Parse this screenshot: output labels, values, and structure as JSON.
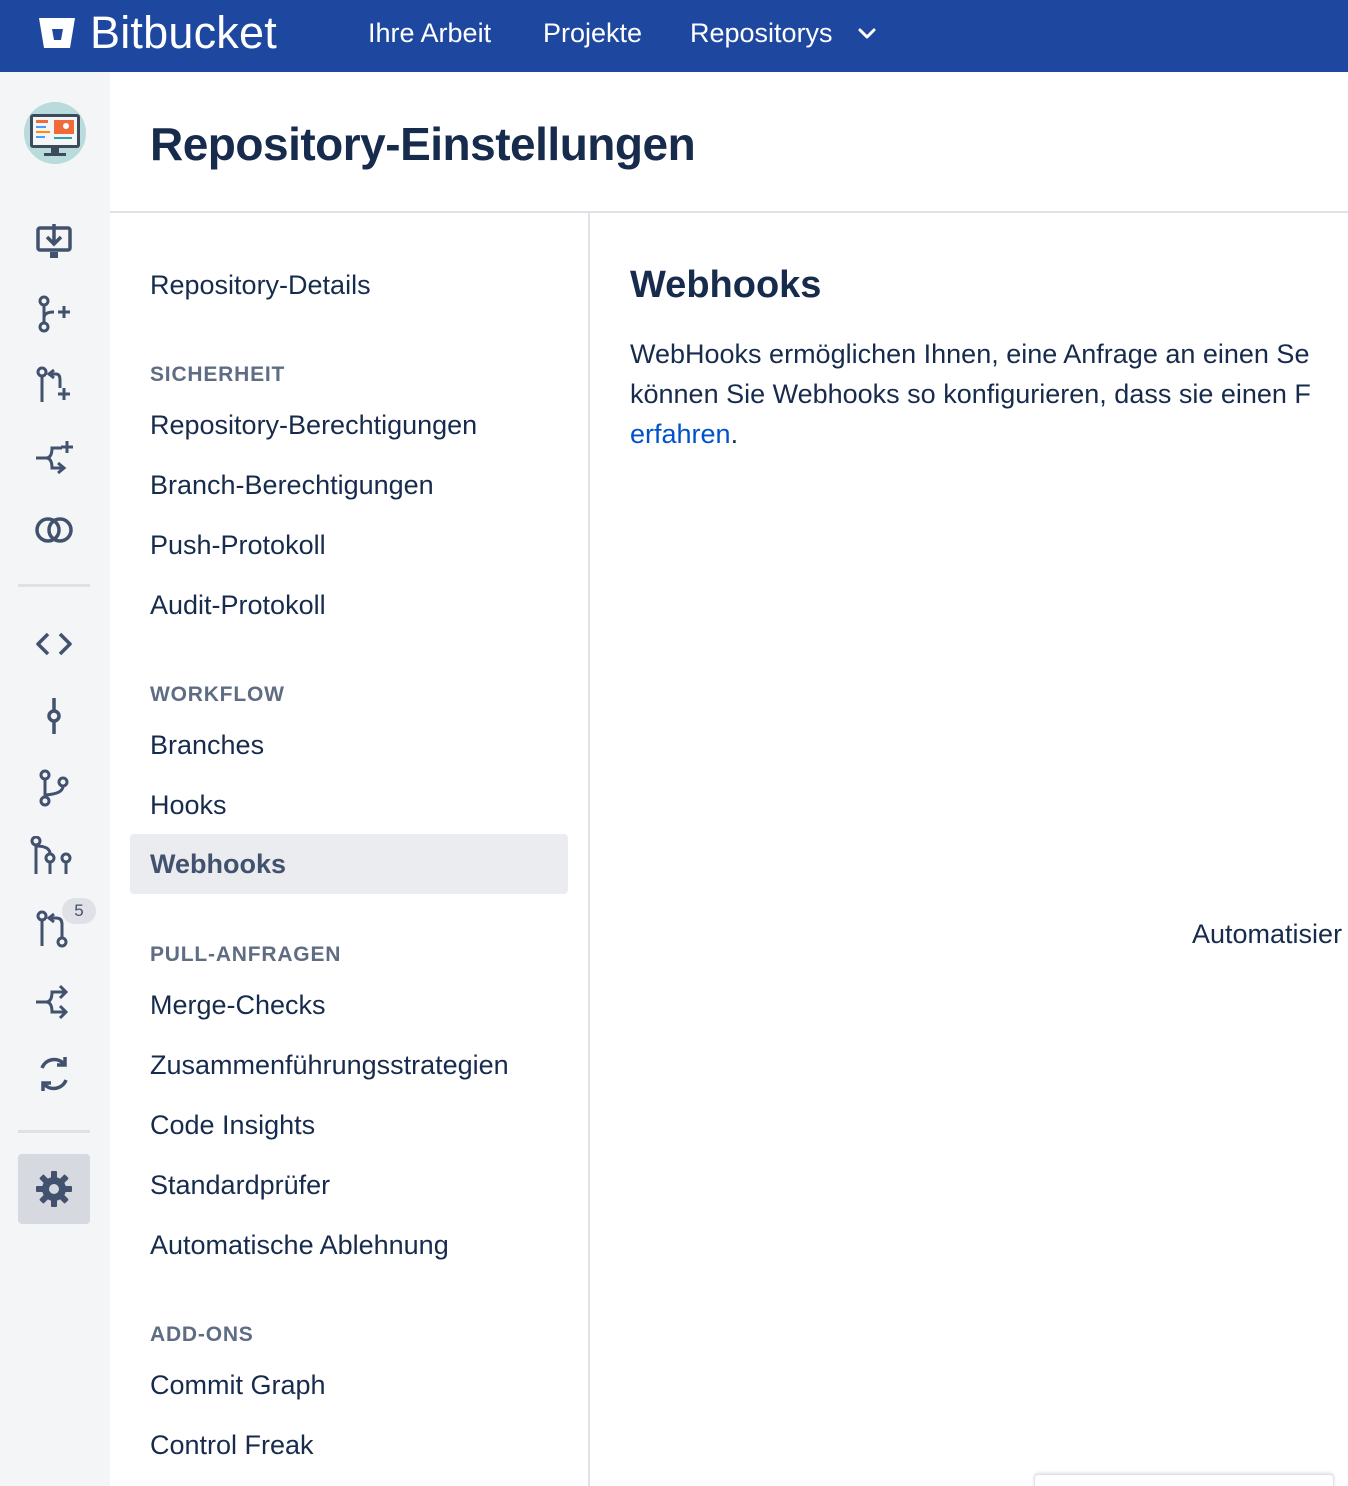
{
  "topnav": {
    "brand": "Bitbucket",
    "items": [
      {
        "label": "Ihre Arbeit"
      },
      {
        "label": "Projekte"
      },
      {
        "label": "Repositorys"
      }
    ],
    "bg_color": "#1e47a0"
  },
  "sidebar": {
    "avatar_icon": "repository-avatar-monitor",
    "icons_top": [
      "clone-icon",
      "create-branch-icon",
      "create-pull-request-icon",
      "create-fork-icon",
      "compare-icon"
    ],
    "icons_bottom": [
      "source-icon",
      "commits-icon",
      "branches-icon",
      "all-branches-graph-icon",
      "pull-requests-icon",
      "forks-icon",
      "builds-icon"
    ],
    "pull_requests_badge": "5",
    "settings_icon": "gear-icon"
  },
  "page": {
    "title": "Repository-Einstellungen"
  },
  "menu": {
    "repo_details": "Repository-Details",
    "sections": [
      {
        "heading": "SICHERHEIT",
        "items": [
          "Repository-Berechtigungen",
          "Branch-Berechtigungen",
          "Push-Protokoll",
          "Audit-Protokoll"
        ]
      },
      {
        "heading": "WORKFLOW",
        "items": [
          "Branches",
          "Hooks",
          "Webhooks"
        ]
      },
      {
        "heading": "PULL-ANFRAGEN",
        "items": [
          "Merge-Checks",
          "Zusammenführungsstrategien",
          "Code Insights",
          "Standardprüfer",
          "Automatische Ablehnung"
        ]
      },
      {
        "heading": "ADD-ONS",
        "items": [
          "Commit Graph",
          "Control Freak"
        ]
      }
    ],
    "active_item": "Webhooks"
  },
  "content": {
    "title": "Webhooks",
    "description_line1": "WebHooks ermöglichen Ihnen, eine Anfrage an einen Se",
    "description_line2": "können Sie Webhooks so konfigurieren, dass sie einen F",
    "description_link": "erfahren",
    "description_end": ".",
    "link_color": "#0052cc",
    "empty_state_text": "Automatisier"
  }
}
